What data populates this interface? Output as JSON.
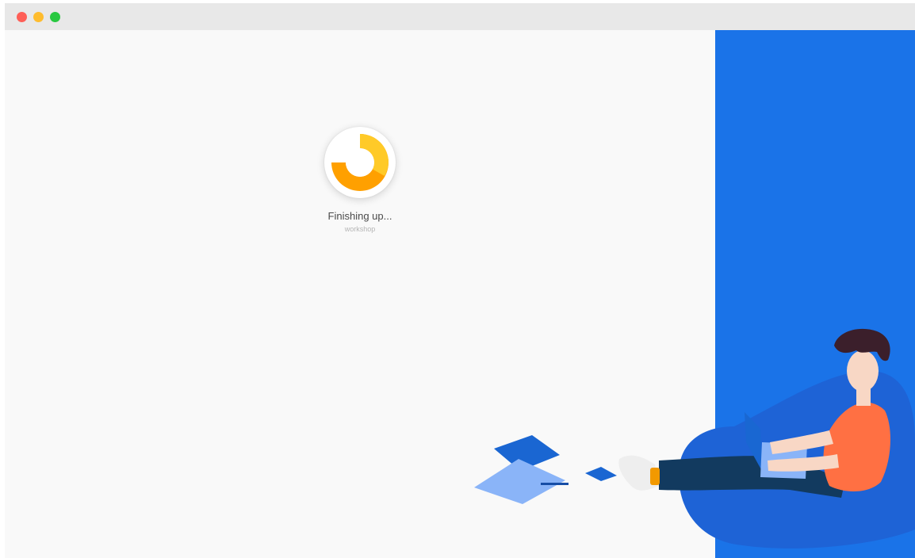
{
  "window": {
    "controls": [
      "close",
      "minimize",
      "maximize"
    ],
    "colors": {
      "close": "#fe5f57",
      "minimize": "#febc2e",
      "maximize": "#28c840"
    }
  },
  "loader": {
    "status": "Finishing up...",
    "app_name": "workshop",
    "icon": "progress-spinner-icon",
    "colors": {
      "primary": "#ffa000",
      "secondary": "#ffca28"
    }
  },
  "illustration": {
    "icon": "person-with-laptop-illustration",
    "accent": "#1a73e8"
  }
}
